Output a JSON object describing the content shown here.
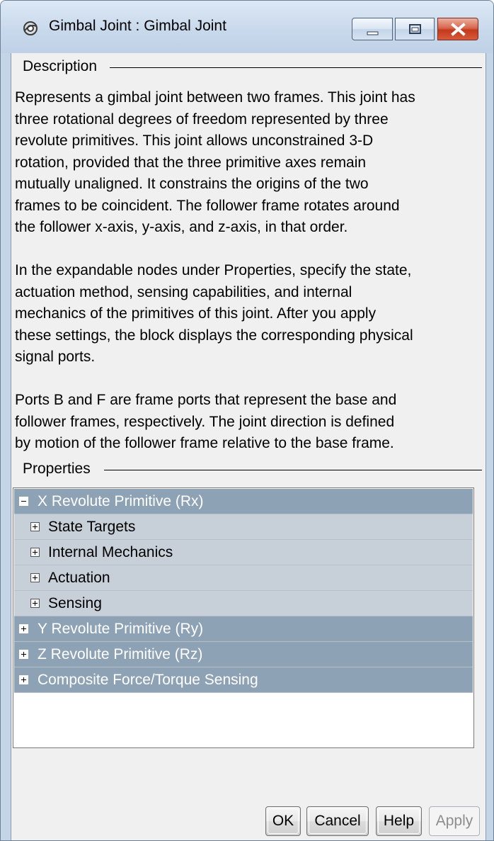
{
  "window": {
    "title": "Gimbal Joint : Gimbal Joint",
    "icon": "gear-icon"
  },
  "description": {
    "group_title": "Description",
    "paragraphs": [
      "Represents a gimbal joint between two frames. This joint has\nthree rotational degrees of freedom represented by three\nrevolute primitives. This joint allows unconstrained 3-D\nrotation, provided that the three primitive axes remain\nmutually unaligned. It constrains the origins of the two\nframes to be coincident. The follower frame rotates around\nthe follower x-axis, y-axis, and z-axis, in that order.",
      "In the expandable nodes under Properties, specify the state,\nactuation method, sensing capabilities, and internal\nmechanics of the primitives of this joint. After you apply\nthese settings, the block displays the corresponding physical\nsignal ports.",
      "Ports B and F are frame ports that represent the base and\nfollower frames, respectively. The joint direction is defined\nby motion of the follower frame relative to the base frame."
    ]
  },
  "properties": {
    "group_title": "Properties",
    "nodes": [
      {
        "label": "X Revolute Primitive (Rx)",
        "expanded": true
      },
      {
        "label": "State Targets",
        "expanded": false
      },
      {
        "label": "Internal Mechanics",
        "expanded": false
      },
      {
        "label": "Actuation",
        "expanded": false
      },
      {
        "label": "Sensing",
        "expanded": false
      },
      {
        "label": "Y Revolute Primitive (Ry)",
        "expanded": false
      },
      {
        "label": "Z Revolute Primitive (Rz)",
        "expanded": false
      },
      {
        "label": "Composite Force/Torque Sensing",
        "expanded": false
      }
    ]
  },
  "buttons": {
    "ok": "OK",
    "cancel": "Cancel",
    "help": "Help",
    "apply": "Apply"
  },
  "colors": {
    "top_node_bg": "#8ea2b6",
    "sub_node_bg": "#c7cfd8",
    "close_button": "#c3391c"
  }
}
